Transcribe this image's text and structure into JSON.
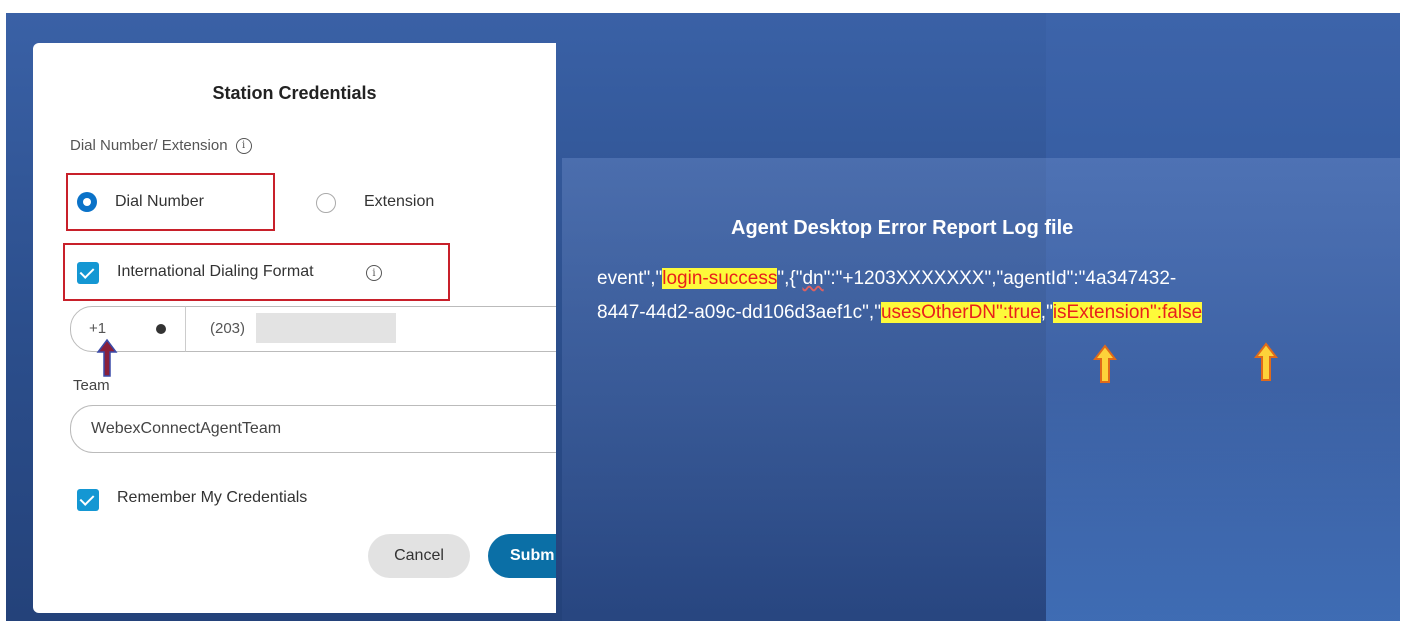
{
  "modal": {
    "title": "Station Credentials",
    "dial_label": "Dial Number/ Extension",
    "info_glyph": "i",
    "radio_dial": "Dial Number",
    "radio_extension": "Extension",
    "intl_format": "International Dialing Format",
    "country_code": "+1",
    "phone_prefix": "(203)",
    "team_label": "Team",
    "team_value": "WebexConnectAgentTeam",
    "remember": "Remember My Credentials",
    "cancel": "Cancel",
    "submit": "Subm"
  },
  "log": {
    "title": "Agent Desktop Error Report Log file",
    "l1a": "event\",\"",
    "l1b": "login-success",
    "l1c": "\",{\"",
    "l1d": "dn",
    "l1e": "\":\"+1203XXXXXXX\",\"agentId\":\"4a347432-",
    "l2a": "8447-44d2-a09c-dd106d3aef1c\",\"",
    "l2b": "usesOtherDN\":true",
    "l2c": ",\"",
    "l2d": "isExtension\":false"
  },
  "colors": {
    "highlight_bg": "#fdfa3a",
    "highlight_text": "#e8201c",
    "accent": "#0a72c8",
    "callout_border": "#c8202a"
  }
}
